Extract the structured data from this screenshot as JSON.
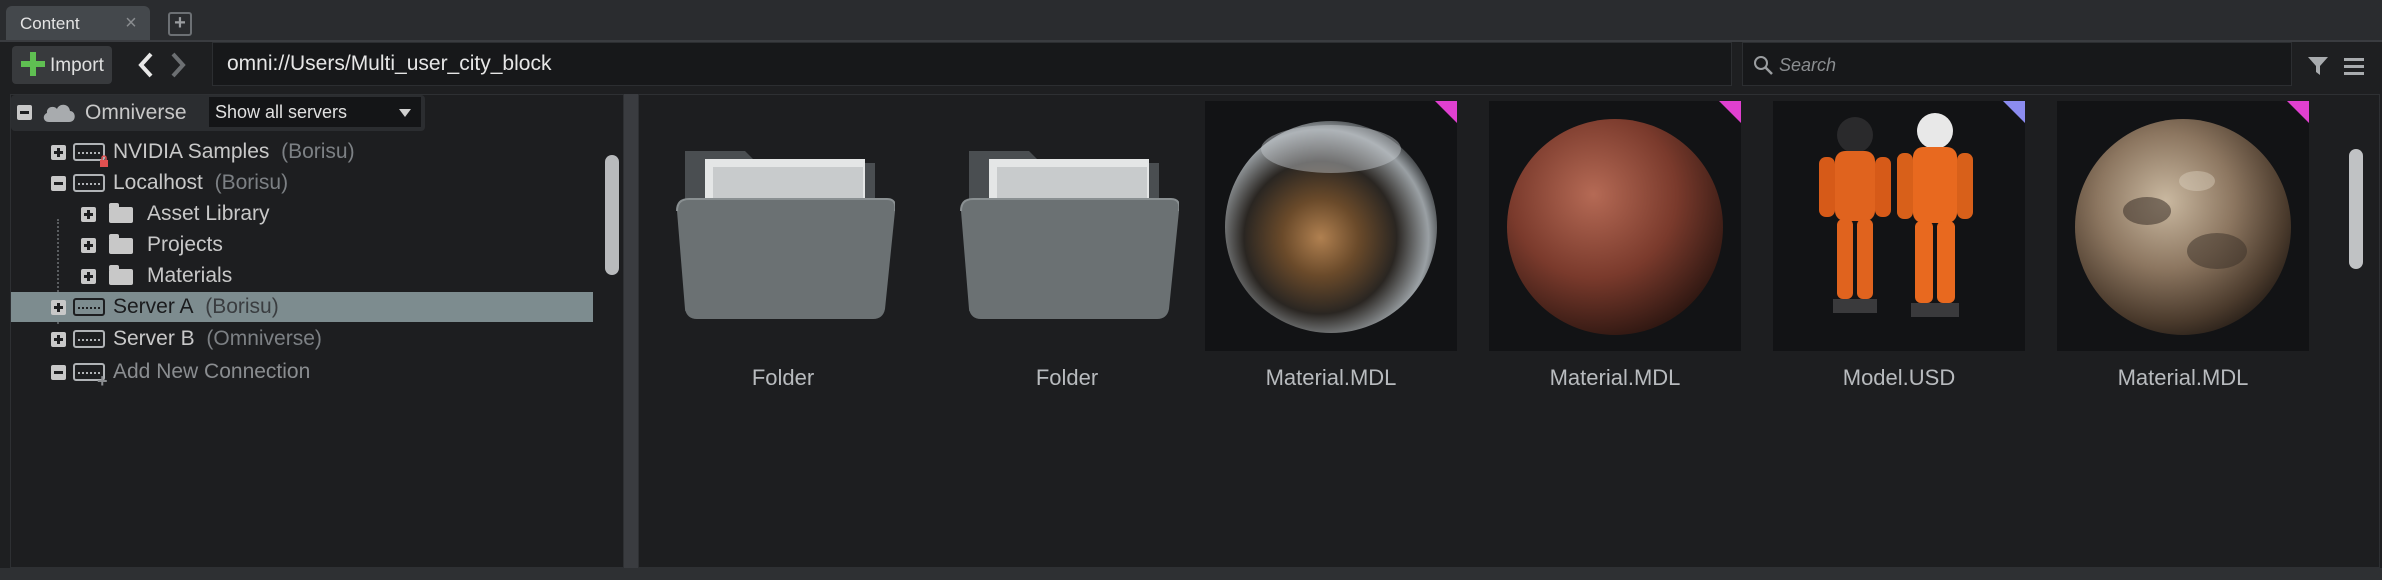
{
  "tabs": [
    {
      "label": "Content"
    }
  ],
  "toolbar": {
    "import_label": "Import",
    "path": "omni://Users/Multi_user_city_block",
    "search_placeholder": "Search"
  },
  "tree": {
    "root_label": "Omniverse",
    "server_filter": "Show all servers",
    "items": [
      {
        "label": "NVIDIA Samples",
        "sub": "(Borisu)"
      },
      {
        "label": "Localhost",
        "sub": "(Borisu)"
      },
      {
        "label": "Asset Library"
      },
      {
        "label": "Projects"
      },
      {
        "label": "Materials"
      },
      {
        "label": "Server A",
        "sub": "(Borisu)"
      },
      {
        "label": "Server B",
        "sub": "(Omniverse)"
      },
      {
        "label": "Add New Connection"
      }
    ]
  },
  "grid": {
    "items": [
      {
        "label": "Folder",
        "kind": "folder"
      },
      {
        "label": "Folder",
        "kind": "folder"
      },
      {
        "label": "Material.MDL",
        "kind": "material-chrome",
        "tag_color": "#e040d0"
      },
      {
        "label": "Material.MDL",
        "kind": "material-clay",
        "tag_color": "#e040d0"
      },
      {
        "label": "Model.USD",
        "kind": "model",
        "tag_color": "#8c8cf0"
      },
      {
        "label": "Material.MDL",
        "kind": "material-rock",
        "tag_color": "#e040d0"
      }
    ]
  },
  "colors": {
    "selection": "#7d8c8f",
    "import_plus": "#5fbf52",
    "tag_mdl": "#e040d0",
    "tag_usd": "#8c8cf0"
  }
}
